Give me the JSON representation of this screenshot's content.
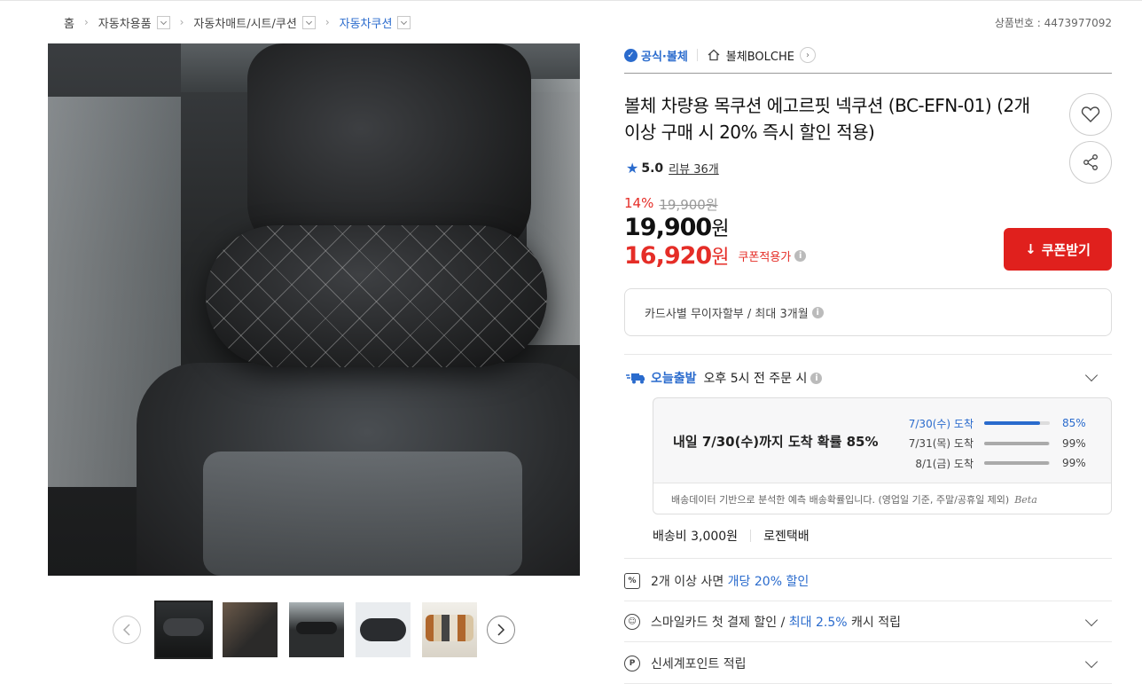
{
  "breadcrumb": {
    "home": "홈",
    "items": [
      "자동차용품",
      "자동차매트/시트/쿠션",
      "자동차쿠션"
    ]
  },
  "product_no": "상품번호 : 4473977092",
  "seller": {
    "official_label": "공식·볼체",
    "store_name": "볼체BOLCHE"
  },
  "product": {
    "title": "볼체 차량용 목쿠션 에고르핏 넥쿠션 (BC-EFN-01) (2개 이상 구매 시 20% 즉시 할인 적용)",
    "rating": "5.0",
    "review_label": "리뷰 36개",
    "discount_rate": "14%",
    "original_price": "19,900원",
    "price": "19,900",
    "price_unit": "원",
    "coupon_price": "16,920",
    "coupon_price_unit": "원",
    "coupon_price_label": "쿠폰적용가",
    "coupon_button": "쿠폰받기",
    "installment": "카드사별 무이자할부 / 최대 3개월"
  },
  "delivery": {
    "badge": "오늘출발",
    "cutoff": "오후 5시 전 주문 시",
    "main": "내일 7/30(수)까지 도착 확률 85%",
    "rows": [
      {
        "date": "7/30(수) 도착",
        "percent": "85%",
        "ratio": 0.85
      },
      {
        "date": "7/31(목) 도착",
        "percent": "99%",
        "ratio": 0.99
      },
      {
        "date": "8/1(금) 도착",
        "percent": "99%",
        "ratio": 0.99
      }
    ],
    "note": "배송데이터 기반으로 분석한 예측 배송확률입니다. (영업일 기준, 주말/공휴일 제외)",
    "beta": "Beta",
    "shipping_fee": "배송비 3,000원",
    "carrier": "로젠택배"
  },
  "benefits": {
    "multi_prefix": "2개 이상 사면",
    "multi_highlight": "개당 20% 할인",
    "smile_prefix": "스마일카드 첫 결제 할인 /",
    "smile_highlight": "최대 2.5%",
    "smile_suffix": "캐시 적립",
    "shinsegae": "신세계포인트 적립"
  },
  "icons": {
    "info": "i",
    "star": "★",
    "home": "home-icon",
    "heart": "heart-icon",
    "share": "share-icon",
    "download": "↓",
    "percent_tag": "%",
    "smile": "☺",
    "point": "P"
  },
  "colors": {
    "accent_blue": "#2a6bcd",
    "accent_red": "#e0201d"
  }
}
